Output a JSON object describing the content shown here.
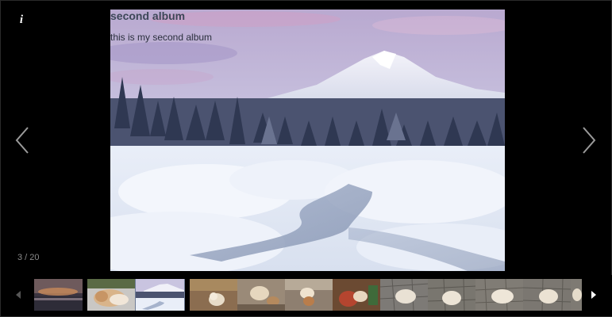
{
  "viewer": {
    "info_glyph": "i",
    "counter_text": "3 / 20",
    "prev_icon": "chevron-left-icon",
    "next_icon": "chevron-right-icon"
  },
  "photo": {
    "title": "second album",
    "description": "this is my second album",
    "subject": "snowy mountain landscape"
  },
  "thumbnails": [
    {
      "subject": "sunset over water",
      "active": false
    },
    {
      "subject": "dog lying down",
      "active": false
    },
    {
      "subject": "snowy mountain",
      "active": true
    },
    {
      "subject": "puppy on floor",
      "active": false
    },
    {
      "subject": "puppy on floor",
      "active": false
    },
    {
      "subject": "puppy on floor",
      "active": false
    },
    {
      "subject": "puppy on carpet",
      "active": false
    },
    {
      "subject": "puppy on tiles",
      "active": false
    },
    {
      "subject": "puppy on tiles",
      "active": false
    },
    {
      "subject": "puppy on tiles",
      "active": false
    },
    {
      "subject": "puppy on tiles",
      "active": false
    },
    {
      "subject": "puppy on tiles",
      "active": false
    }
  ],
  "strip": {
    "prev_icon": "triangle-left-icon",
    "next_icon": "triangle-right-icon"
  },
  "colors": {
    "background": "#000000",
    "counter_text": "#8a8a8a",
    "arrow": "#9a9a9a"
  }
}
